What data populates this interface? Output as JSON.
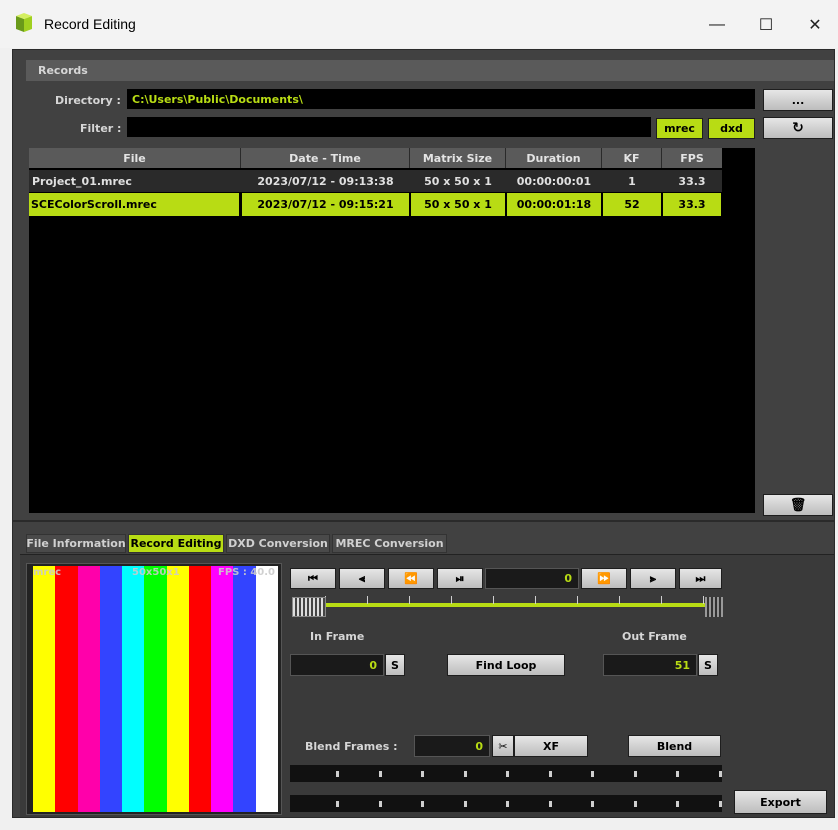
{
  "window": {
    "title": "Record Editing",
    "minimize_icon": "minimize-icon",
    "maximize_icon": "maximize-icon",
    "close_icon": "close-icon",
    "minimize_glyph": "—",
    "maximize_glyph": "☐",
    "close_glyph": "✕"
  },
  "records": {
    "section_label": "Records",
    "directory_label": "Directory :",
    "directory_value": "C:\\Users\\Public\\Documents\\",
    "browse_label": "...",
    "filter_label": "Filter :",
    "filter_value": "",
    "filter_mrec": "mrec",
    "filter_dxd": "dxd",
    "refresh_glyph": "↻",
    "delete_glyph": "🗑",
    "columns": [
      "File",
      "Date - Time",
      "Matrix Size",
      "Duration",
      "KF",
      "FPS"
    ],
    "rows": [
      {
        "file": "Project_01.mrec",
        "datetime": "2023/07/12 - 09:13:38",
        "matrix": "50 x 50 x 1",
        "duration": "00:00:00:01",
        "kf": "1",
        "fps": "33.3",
        "selected": false
      },
      {
        "file": "SCEColorScroll.mrec",
        "datetime": "2023/07/12 - 09:15:21",
        "matrix": "50 x 50 x 1",
        "duration": "00:00:01:18",
        "kf": "52",
        "fps": "33.3",
        "selected": true
      }
    ]
  },
  "tabs": [
    "File Information",
    "Record Editing",
    "DXD Conversion",
    "MREC Conversion"
  ],
  "active_tab": "Record Editing",
  "preview": {
    "label_left": "mrec",
    "label_mid": "50x50x1",
    "label_right": "FPS : 40.0",
    "stripe_colors": [
      "#ffff00",
      "#ff0000",
      "#ff00aa",
      "#3344ff",
      "#00ffff",
      "#00ff00",
      "#ffff00",
      "#ff0000",
      "#ff00ff",
      "#3344ff",
      "#ffffff"
    ]
  },
  "transport": {
    "first_glyph": "⏮",
    "prev_key_glyph": "⫷",
    "rewind_glyph": "⏪",
    "play_pause_glyph": "⏯",
    "frame_value": "0",
    "ffwd_glyph": "⏩",
    "next_key_glyph": "⫸",
    "last_glyph": "⏭"
  },
  "editing": {
    "in_frame_label": "In Frame",
    "in_frame_value": "0",
    "in_set_label": "S",
    "find_loop_label": "Find Loop",
    "out_frame_label": "Out Frame",
    "out_frame_value": "51",
    "out_set_label": "S",
    "blend_frames_label": "Blend Frames :",
    "blend_frames_value": "0",
    "scissors_glyph": "✂",
    "xf_label": "XF",
    "blend_label": "Blend",
    "export_label": "Export"
  },
  "colors": {
    "accent": "#b8dc14",
    "panel": "#414141",
    "field": "#000000"
  }
}
